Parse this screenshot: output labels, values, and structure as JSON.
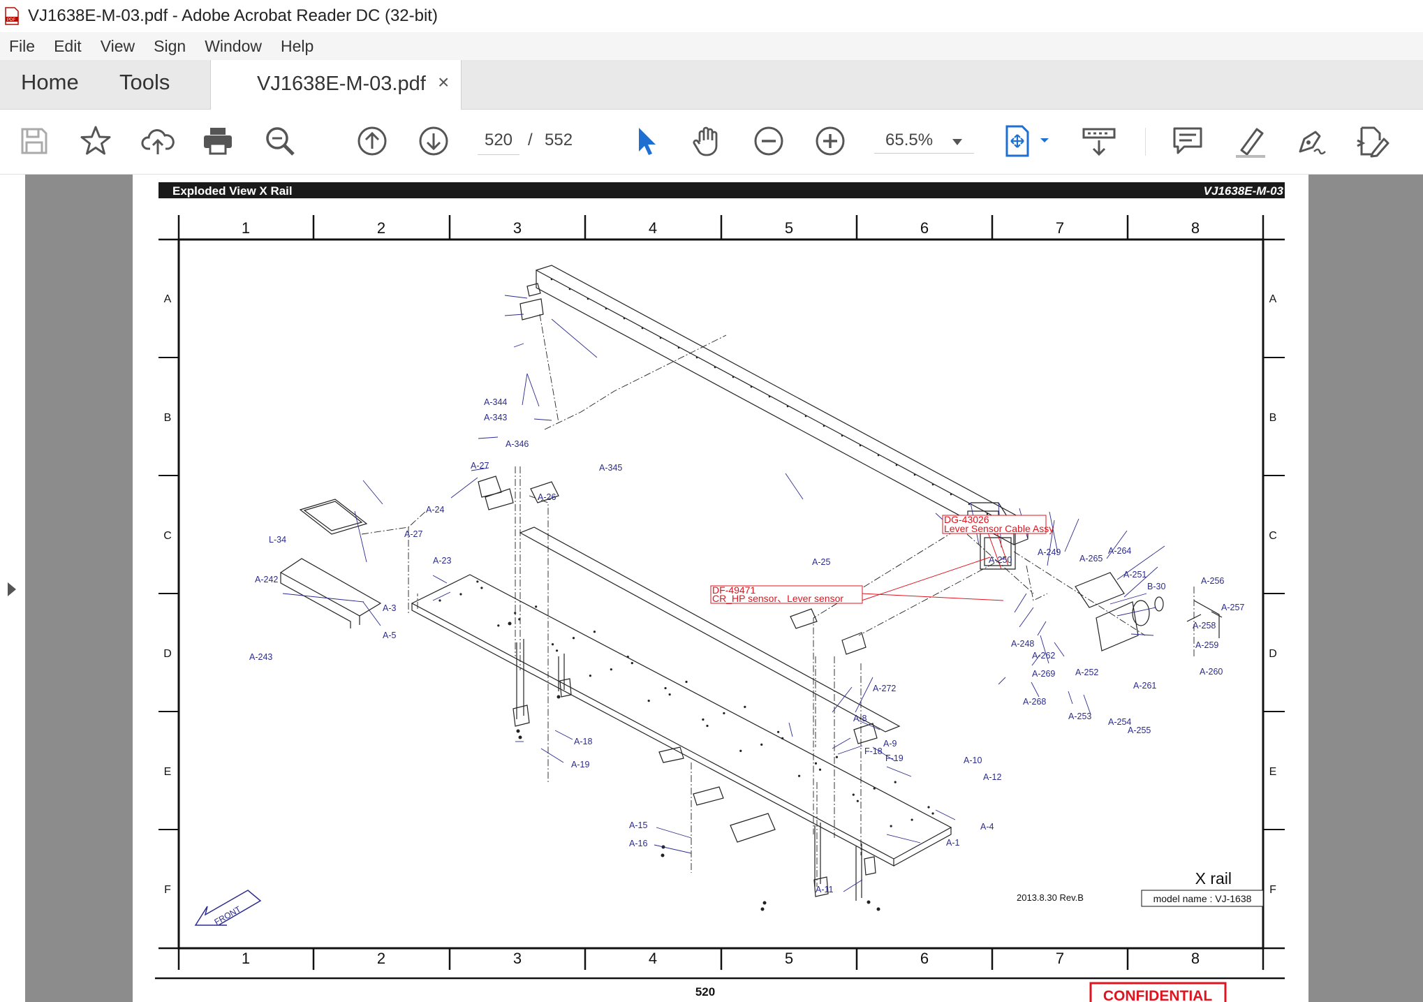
{
  "window": {
    "title": "VJ1638E-M-03.pdf - Adobe Acrobat Reader DC (32-bit)"
  },
  "menu": [
    "File",
    "Edit",
    "View",
    "Sign",
    "Window",
    "Help"
  ],
  "tabs": {
    "home": "Home",
    "tools": "Tools",
    "document": "VJ1638E-M-03.pdf",
    "close": "×"
  },
  "toolbar": {
    "current_page": "520",
    "separator": "/",
    "total_pages": "552",
    "zoom": "65.5%",
    "icons": [
      "save-icon",
      "bookmark-star-icon",
      "upload-cloud-icon",
      "print-icon",
      "zoom-search-icon",
      "page-up-icon",
      "page-down-icon",
      "select-pointer-icon",
      "hand-pan-icon",
      "zoom-out-icon",
      "zoom-in-icon",
      "fit-page-icon",
      "scroll-mode-icon",
      "comment-icon",
      "highlight-pen-icon",
      "sign-icon",
      "edit-export-icon"
    ]
  },
  "pdf": {
    "header_left": "Exploded View X Rail",
    "header_right": "VJ1638E-M-03",
    "col_numbers": [
      "1",
      "2",
      "3",
      "4",
      "5",
      "6",
      "7",
      "8"
    ],
    "row_letters": [
      "A",
      "B",
      "C",
      "D",
      "E",
      "F"
    ],
    "title": "X rail",
    "revision": "2013.8.30 Rev.B",
    "model": "model name : VJ-1638",
    "page_number": "520",
    "confidential": "CONFIDENTIAL",
    "front_label": "FRONT",
    "callouts": [
      {
        "code": "DG-43026",
        "desc": "Lever Sensor Cable Assy"
      },
      {
        "code": "DF-49471",
        "desc": "CR_HP sensor、Lever sensor"
      }
    ],
    "part_labels": [
      "A-344",
      "A-343",
      "A-346",
      "A-345",
      "A-27",
      "A-26",
      "A-24",
      "A-27",
      "A-23",
      "L-34",
      "A-242",
      "A-243",
      "A-3",
      "A-5",
      "A-25",
      "A-250",
      "A-249",
      "A-265",
      "A-264",
      "A-251",
      "B-30",
      "A-256",
      "A-257",
      "A-258",
      "A-259",
      "A-260",
      "A-248",
      "A-262",
      "A-269",
      "A-252",
      "A-261",
      "A-268",
      "A-253",
      "A-254",
      "A-255",
      "A-272",
      "A-8",
      "A-9",
      "F-18",
      "F-19",
      "A-10",
      "A-12",
      "A-18",
      "A-19",
      "A-15",
      "A-16",
      "A-4",
      "A-1",
      "A-11"
    ]
  }
}
